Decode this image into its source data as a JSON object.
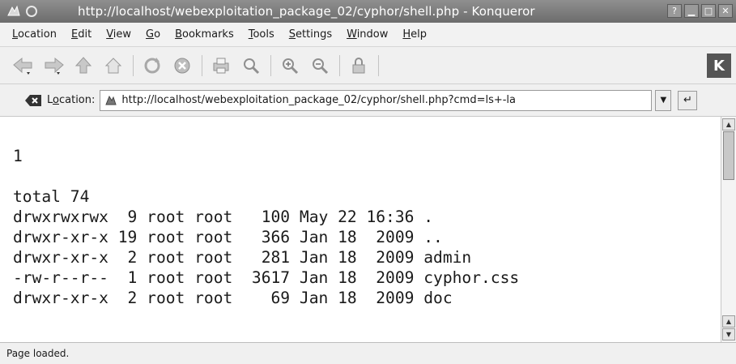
{
  "window": {
    "title": "http://localhost/webexploitation_package_02/cyphor/shell.php - Konqueror",
    "controls": [
      "?",
      "▁",
      "□",
      "✕"
    ]
  },
  "menu": [
    {
      "label": "Location",
      "accel": "L",
      "rest": "ocation"
    },
    {
      "label": "Edit",
      "accel": "E",
      "rest": "dit"
    },
    {
      "label": "View",
      "accel": "V",
      "rest": "iew"
    },
    {
      "label": "Go",
      "accel": "G",
      "rest": "o"
    },
    {
      "label": "Bookmarks",
      "accel": "B",
      "rest": "ookmarks"
    },
    {
      "label": "Tools",
      "accel": "T",
      "rest": "ools"
    },
    {
      "label": "Settings",
      "accel": "S",
      "rest": "ettings"
    },
    {
      "label": "Window",
      "accel": "W",
      "rest": "indow"
    },
    {
      "label": "Help",
      "accel": "H",
      "rest": "elp"
    }
  ],
  "toolbar": {
    "icons": [
      "back-icon",
      "forward-icon",
      "up-icon",
      "home-icon",
      "reload-icon",
      "stop-icon",
      "print-icon",
      "find-icon",
      "zoom-in-icon",
      "zoom-out-icon",
      "security-icon"
    ],
    "kde_logo": "K"
  },
  "location": {
    "label_accel": "o",
    "label_pre": "L",
    "label_post": "cation:",
    "url": "http://localhost/webexploitation_package_02/cyphor/shell.php?cmd=ls+-la"
  },
  "content": {
    "first_line": "1",
    "lines": [
      "total 74",
      "drwxrwxrwx  9 root root   100 May 22 16:36 .",
      "drwxr-xr-x 19 root root   366 Jan 18  2009 ..",
      "drwxr-xr-x  2 root root   281 Jan 18  2009 admin",
      "-rw-r--r--  1 root root  3617 Jan 18  2009 cyphor.css",
      "drwxr-xr-x  2 root root    69 Jan 18  2009 doc"
    ]
  },
  "status": {
    "text": "Page loaded."
  },
  "colors": {
    "titlebar": "#7d7d7d",
    "chrome_bg": "#f0f0f0",
    "content_bg": "#ffffff"
  }
}
